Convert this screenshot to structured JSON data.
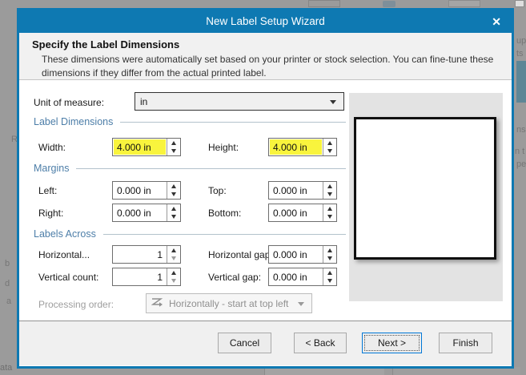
{
  "window": {
    "title": "New Label Setup Wizard",
    "close_icon": "✕"
  },
  "header": {
    "title": "Specify the Label Dimensions",
    "description": "These dimensions were automatically set based on your printer or stock selection. You can fine-tune these dimensions if they differ from the actual printed label."
  },
  "form": {
    "unit_of_measure": {
      "label": "Unit of measure:",
      "value": "in"
    },
    "sections": {
      "label_dimensions": "Label Dimensions",
      "margins": "Margins",
      "labels_across": "Labels Across"
    },
    "fields": {
      "width": {
        "label": "Width:",
        "value": "4.000 in",
        "highlighted": true
      },
      "height": {
        "label": "Height:",
        "value": "4.000 in",
        "highlighted": true
      },
      "left": {
        "label": "Left:",
        "value": "0.000 in"
      },
      "top": {
        "label": "Top:",
        "value": "0.000 in"
      },
      "right": {
        "label": "Right:",
        "value": "0.000 in"
      },
      "bottom": {
        "label": "Bottom:",
        "value": "0.000 in"
      },
      "horizontal_count": {
        "label": "Horizontal...",
        "value": "1"
      },
      "horizontal_gap": {
        "label": "Horizontal gap:",
        "value": "0.000 in"
      },
      "vertical_count": {
        "label": "Vertical count:",
        "value": "1"
      },
      "vertical_gap": {
        "label": "Vertical gap:",
        "value": "0.000 in"
      }
    },
    "processing_order": {
      "label": "Processing order:",
      "value": "Horizontally - start at top left",
      "disabled": true
    }
  },
  "footer": {
    "buttons": [
      {
        "label": "Cancel"
      },
      {
        "label": "< Back"
      },
      {
        "label": "Next >",
        "focused": true
      },
      {
        "label": "Finish"
      }
    ]
  },
  "colors": {
    "titlebar_blue": "#0e79b2",
    "section_blue": "#4d7ea8",
    "highlight_yellow": "#f9f43d",
    "focus_blue": "#0078d7"
  },
  "background_fragments": {
    "bottom_left": "ata",
    "right_top_1": "up",
    "right_top_2": "ts",
    "right_mid_1": "ns",
    "right_mid_2": "n t",
    "right_mid_3": "pe",
    "left_1": "R",
    "left_2": "b",
    "left_3": "d",
    "left_4": "a"
  }
}
